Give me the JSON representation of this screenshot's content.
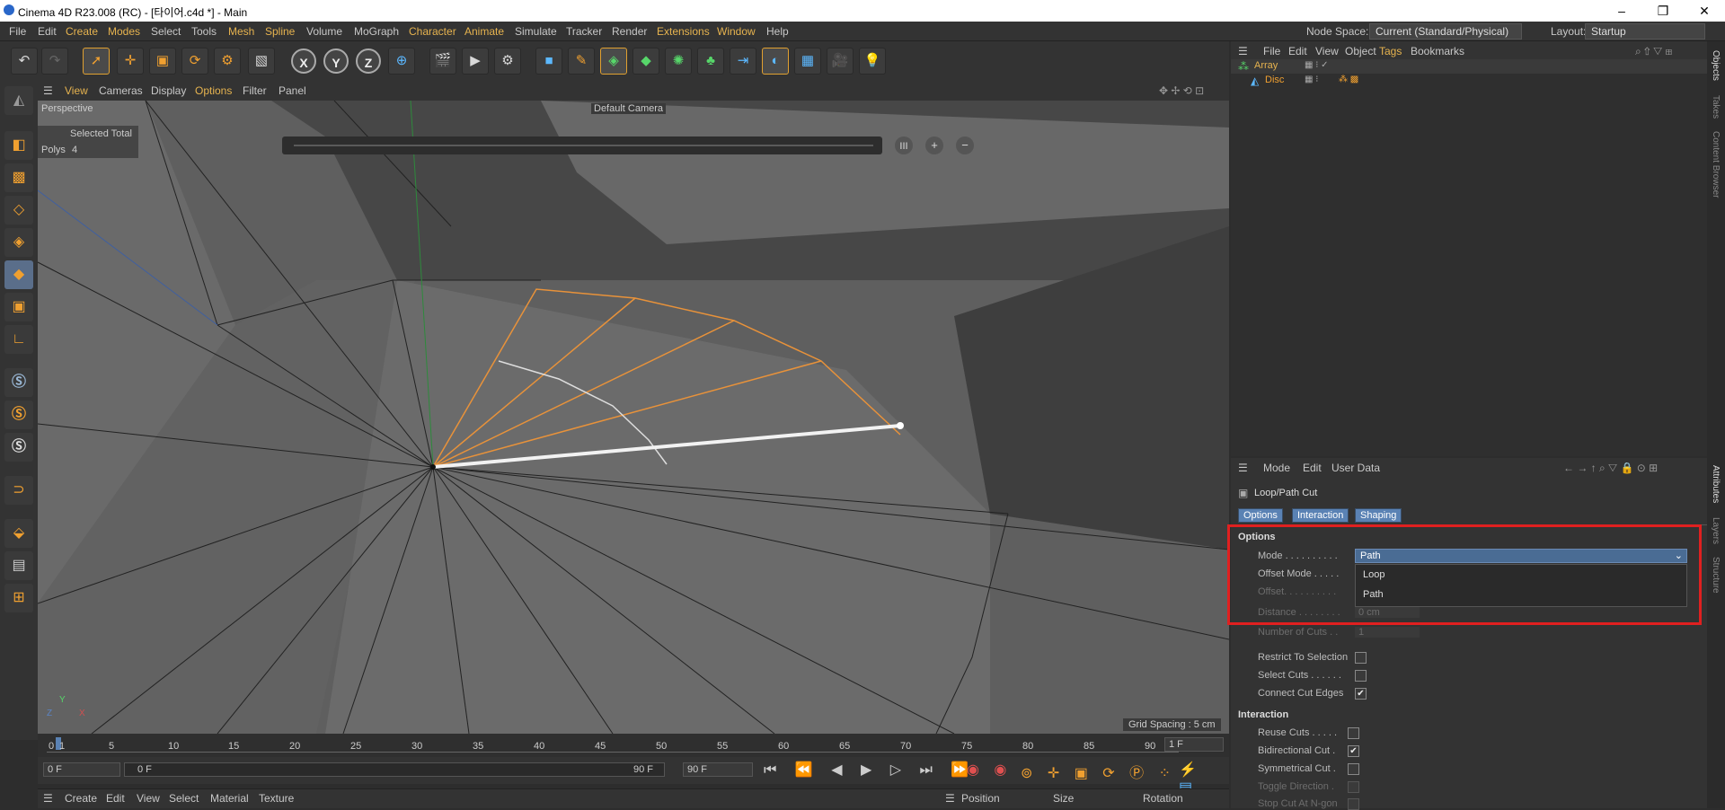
{
  "window": {
    "title": "Cinema 4D R23.008 (RC) - [타이어.c4d *] - Main",
    "min": "–",
    "restore": "❐",
    "close": "✕"
  },
  "menubar": {
    "items": [
      "File",
      "Edit",
      "Create",
      "Modes",
      "Select",
      "Tools",
      "Mesh",
      "Spline",
      "Volume",
      "MoGraph",
      "Character",
      "Animate",
      "Simulate",
      "Tracker",
      "Render",
      "Extensions",
      "Window",
      "Help"
    ],
    "node_space_label": "Node Space:",
    "node_space_value": "Current (Standard/Physical)",
    "layout_label": "Layout:",
    "layout_value": "Startup"
  },
  "viewport": {
    "menu": [
      "View",
      "Cameras",
      "Display",
      "Options",
      "Filter",
      "Panel"
    ],
    "name": "Perspective",
    "camera": "Default Camera",
    "selected_total": "Selected Total",
    "polys_label": "Polys",
    "polys_value": "4",
    "grid_spacing": "Grid Spacing : 5 cm"
  },
  "timeline": {
    "ticks": [
      "0",
      "1",
      "5",
      "10",
      "15",
      "20",
      "25",
      "30",
      "35",
      "40",
      "45",
      "50",
      "55",
      "60",
      "65",
      "70",
      "75",
      "80",
      "85",
      "90"
    ],
    "current_frame": "1 F",
    "start": "0 F",
    "min_field": "0 F",
    "max_field": "90 F",
    "end": "90 F"
  },
  "bottom": {
    "menu": [
      "Create",
      "Edit",
      "View",
      "Select",
      "Material",
      "Texture"
    ],
    "coord_headers": [
      "Position",
      "Size",
      "Rotation"
    ]
  },
  "objects": {
    "menu": [
      "File",
      "Edit",
      "View",
      "Object",
      "Tags",
      "Bookmarks"
    ],
    "items": [
      {
        "name": "Array"
      },
      {
        "name": "Disc"
      }
    ]
  },
  "attributes": {
    "menu": [
      "Mode",
      "Edit",
      "User Data"
    ],
    "tool_name": "Loop/Path Cut",
    "tabs": [
      "Options",
      "Interaction",
      "Shaping"
    ],
    "options_header": "Options",
    "fields": {
      "mode_label": "Mode . . . . . . . . . .",
      "mode_value": "Path",
      "offset_mode_label": "Offset Mode . . . . .",
      "offset_label": "Offset. . . . . . . . . .",
      "distance_label": "Distance . . . . . . . .",
      "distance_value": "0 cm",
      "cuts_label": "Number of Cuts . .",
      "cuts_value": "1"
    },
    "dropdown_options": [
      "Loop",
      "Path"
    ],
    "checks": [
      {
        "label": "Restrict To Selection",
        "checked": false
      },
      {
        "label": "Select Cuts . . . . . .",
        "checked": false
      },
      {
        "label": "Connect Cut Edges",
        "checked": true
      }
    ],
    "interaction_header": "Interaction",
    "interaction_checks": [
      {
        "label": "Reuse Cuts . . . . .",
        "checked": false
      },
      {
        "label": "Bidirectional Cut .",
        "checked": true
      },
      {
        "label": "Symmetrical Cut .",
        "checked": false
      },
      {
        "label": "Toggle Direction .",
        "checked": false
      },
      {
        "label": "Stop Cut At N-gon",
        "checked": false
      }
    ]
  },
  "side_tabs": [
    "Objects",
    "Takes",
    "Content Browser",
    "Attributes",
    "Layers",
    "Structure"
  ]
}
